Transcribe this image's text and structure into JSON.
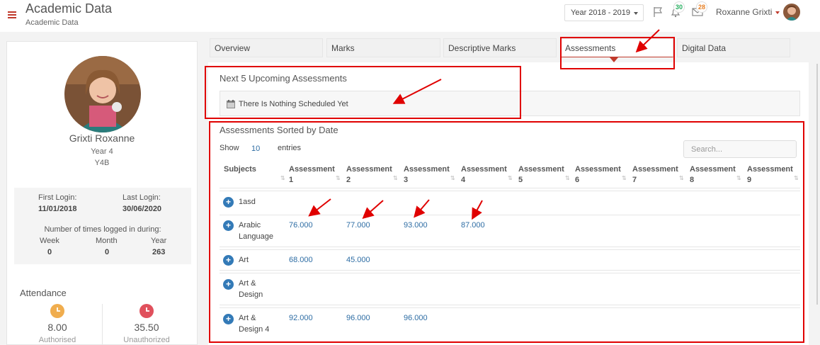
{
  "header": {
    "title": "Academic Data",
    "subtitle": "Academic Data",
    "year_select": "Year 2018 - 2019",
    "notifications_count": "30",
    "messages_count": "28",
    "user_name": "Roxanne Grixti"
  },
  "profile": {
    "name": "Grixti Roxanne",
    "year": "Year 4",
    "class": "Y4B",
    "first_login_label": "First Login:",
    "first_login": "11/01/2018",
    "last_login_label": "Last Login:",
    "last_login": "30/06/2020",
    "times_logged_label": "Number of times logged in during:",
    "periods": [
      {
        "label": "Week",
        "value": "0"
      },
      {
        "label": "Month",
        "value": "0"
      },
      {
        "label": "Year",
        "value": "263"
      }
    ],
    "attendance_title": "Attendance",
    "authorised_value": "8.00",
    "authorised_label": "Authorised",
    "unauthorized_value": "35.50",
    "unauthorized_label": "Unauthorized"
  },
  "tabs": [
    {
      "label": "Overview"
    },
    {
      "label": "Marks"
    },
    {
      "label": "Descriptive Marks"
    },
    {
      "label": "Assessments",
      "active": true
    },
    {
      "label": "Digital Data"
    }
  ],
  "upcoming": {
    "title": "Next 5 Upcoming Assessments",
    "empty_text": "There Is Nothing Scheduled Yet"
  },
  "assessments": {
    "title": "Assessments Sorted by Date",
    "show_label": "Show",
    "show_value": "10",
    "entries_label": "entries",
    "search_placeholder": "Search...",
    "columns": [
      {
        "l1": "Subjects",
        "l2": ""
      },
      {
        "l1": "Assessment",
        "l2": "1"
      },
      {
        "l1": "Assessment",
        "l2": "2"
      },
      {
        "l1": "Assessment",
        "l2": "3"
      },
      {
        "l1": "Assessment",
        "l2": "4"
      },
      {
        "l1": "Assessment",
        "l2": "5"
      },
      {
        "l1": "Assessment",
        "l2": "6"
      },
      {
        "l1": "Assessment",
        "l2": "7"
      },
      {
        "l1": "Assessment",
        "l2": "8"
      },
      {
        "l1": "Assessment",
        "l2": "9"
      }
    ],
    "rows": [
      {
        "subject_l1": "1asd",
        "subject_l2": "",
        "marks": []
      },
      {
        "subject_l1": "Arabic",
        "subject_l2": "Language",
        "marks": [
          "76.000",
          "77.000",
          "93.000",
          "87.000"
        ]
      },
      {
        "subject_l1": "Art",
        "subject_l2": "",
        "marks": [
          "68.000",
          "45.000"
        ]
      },
      {
        "subject_l1": "Art &",
        "subject_l2": "Design",
        "marks": []
      },
      {
        "subject_l1": "Art &",
        "subject_l2": "Design 4",
        "marks": [
          "92.000",
          "96.000",
          "96.000"
        ]
      }
    ]
  },
  "colors": {
    "accent_red": "#c0392b",
    "link_blue": "#2e6da4",
    "annotation_red": "#e00000",
    "authorised": "#f0ad4e",
    "unauthorized": "#e0505c"
  },
  "icons": [
    "menu-icon",
    "flag-icon",
    "bell-icon",
    "mail-icon",
    "calendar-icon",
    "clock-icon",
    "plus-icon",
    "sort-icon"
  ]
}
